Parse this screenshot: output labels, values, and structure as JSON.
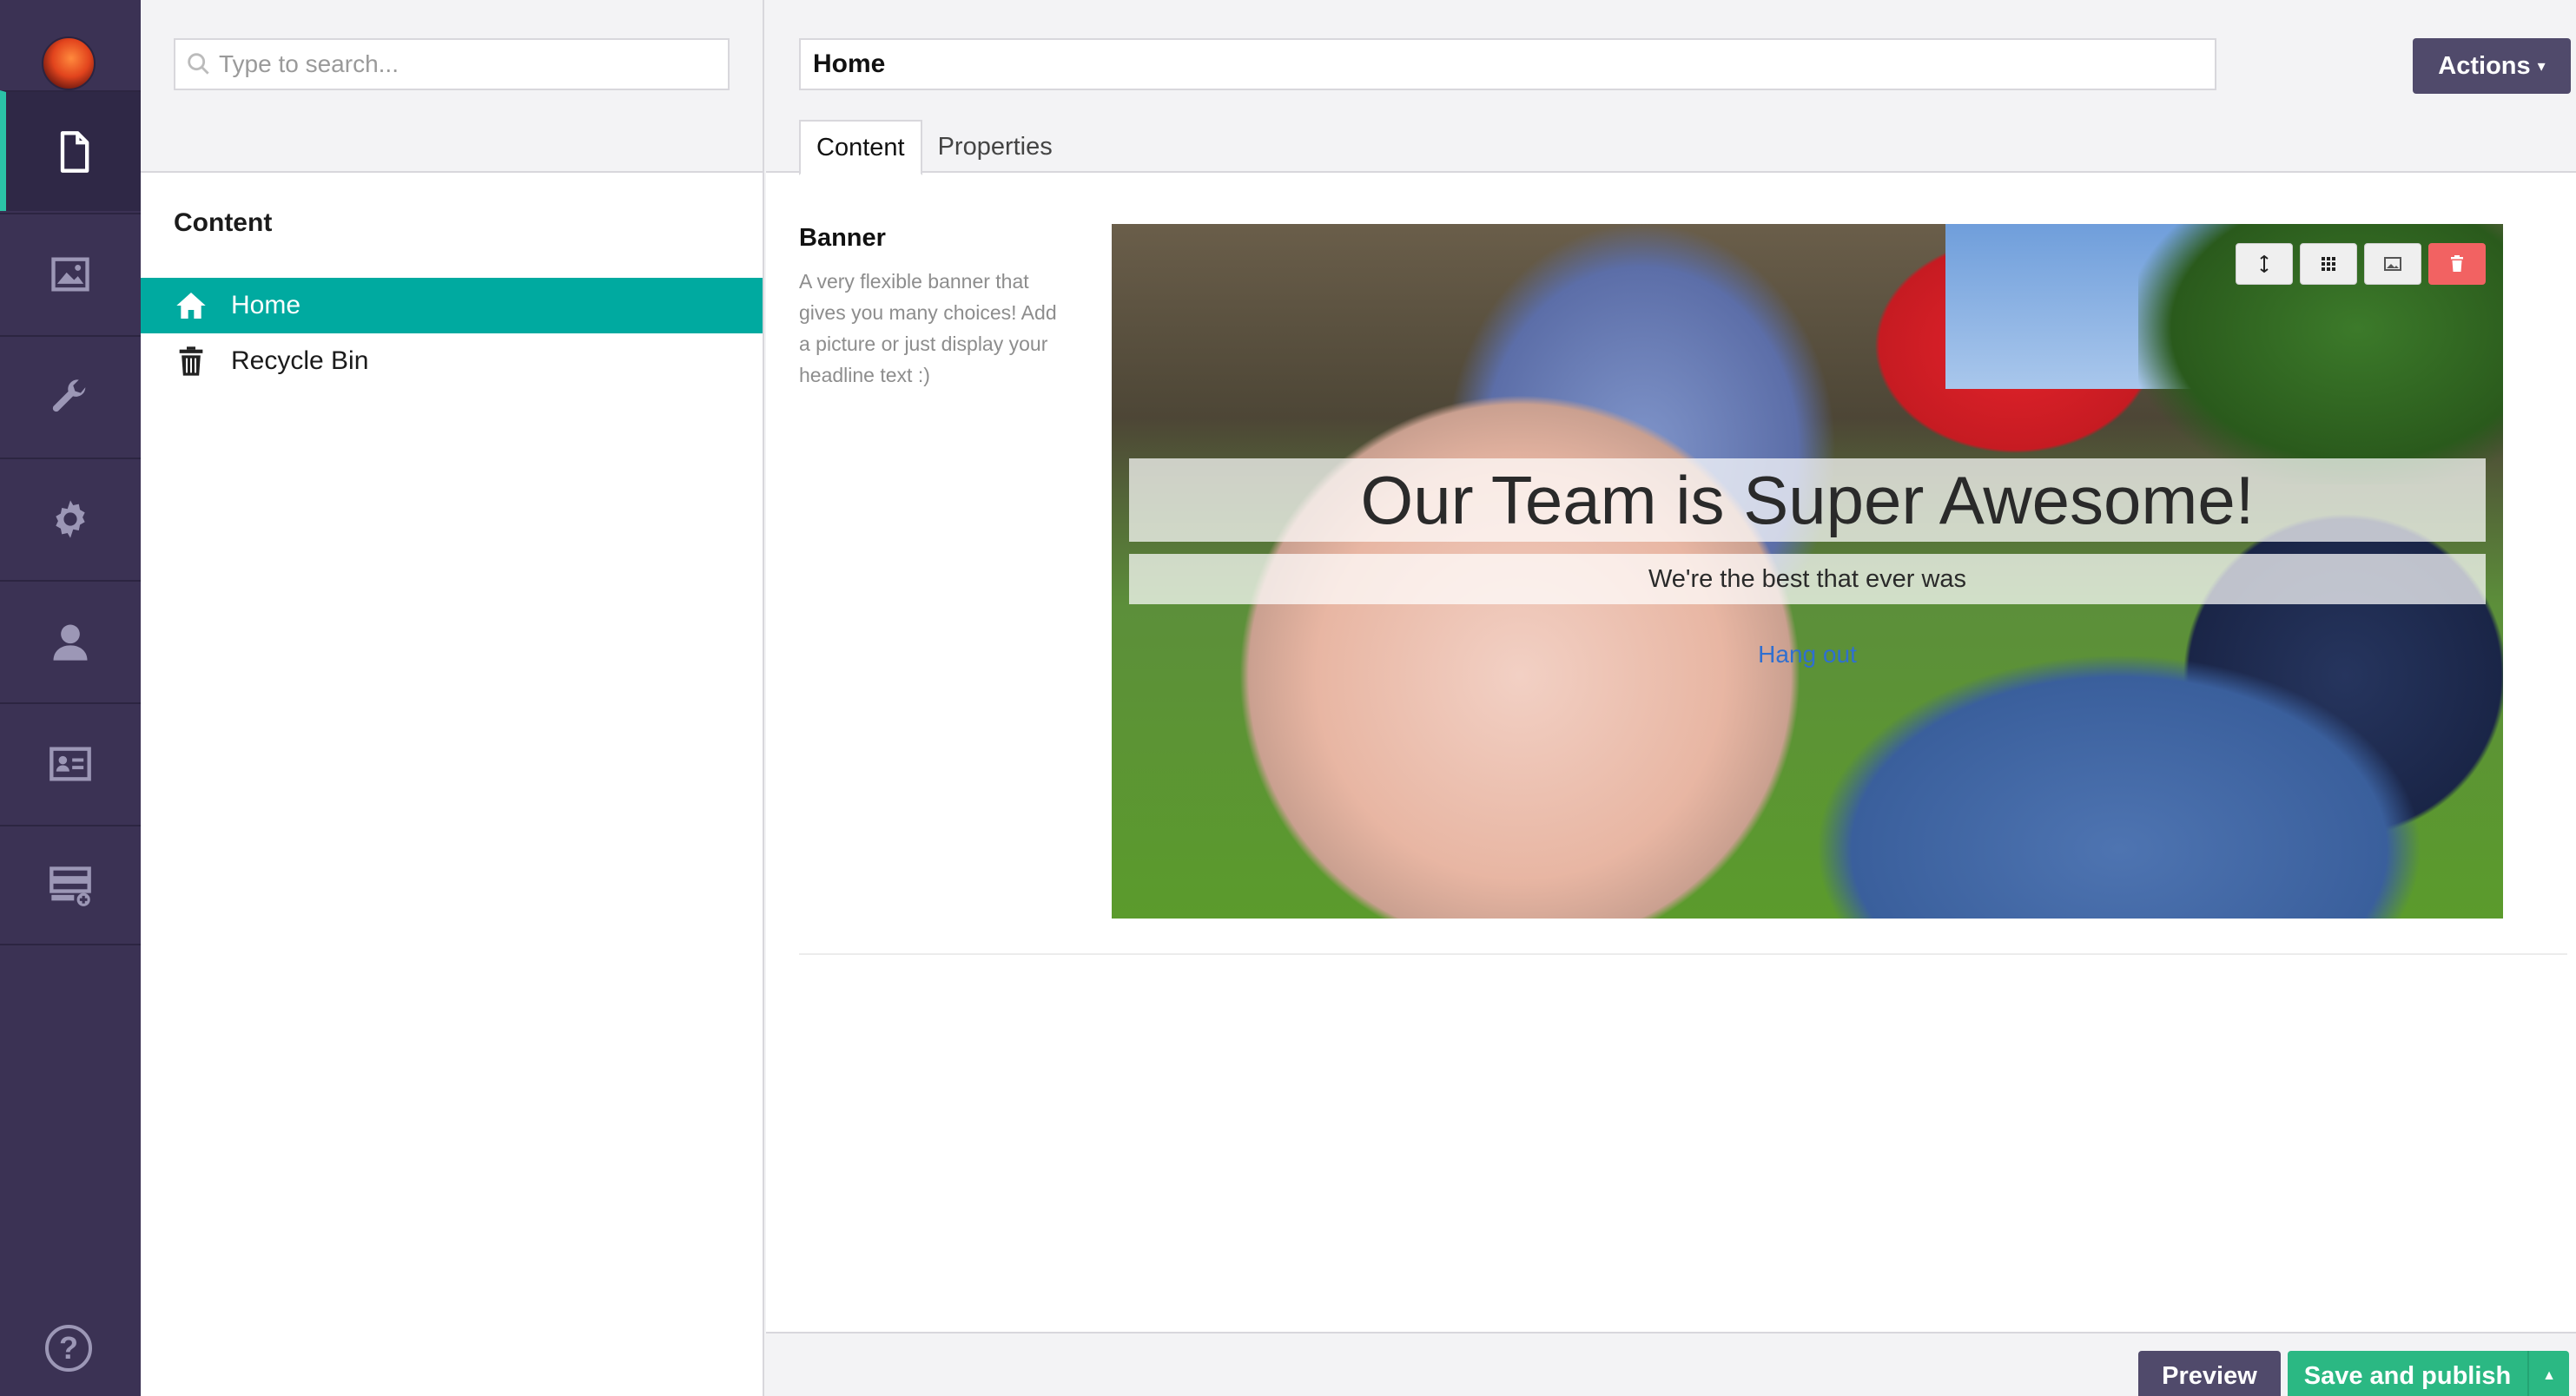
{
  "sidebar": {
    "sections": [
      {
        "name": "content",
        "icon": "document-icon",
        "active": true
      },
      {
        "name": "media",
        "icon": "image-icon",
        "active": false
      },
      {
        "name": "developer",
        "icon": "wrench-icon",
        "active": false
      },
      {
        "name": "settings",
        "icon": "gear-icon",
        "active": false
      },
      {
        "name": "users",
        "icon": "user-icon",
        "active": false
      },
      {
        "name": "members",
        "icon": "id-card-icon",
        "active": false
      },
      {
        "name": "forms",
        "icon": "form-icon",
        "active": false
      }
    ],
    "help_label": "?"
  },
  "tree": {
    "search_placeholder": "Type to search...",
    "title": "Content",
    "items": [
      {
        "label": "Home",
        "icon": "home-icon",
        "selected": true
      },
      {
        "label": "Recycle Bin",
        "icon": "trash-icon",
        "selected": false
      }
    ]
  },
  "editor": {
    "node_name": "Home",
    "actions_label": "Actions",
    "tabs": [
      {
        "label": "Content",
        "active": true
      },
      {
        "label": "Properties",
        "active": false
      }
    ],
    "property": {
      "label": "Banner",
      "description": "A very flexible banner that gives you many choices! Add a picture or just display your headline text :)"
    },
    "banner": {
      "headline": "Our Team is Super Awesome!",
      "subheadline": "We're the best that ever was",
      "link_text": "Hang out"
    },
    "footer": {
      "preview_label": "Preview",
      "publish_label": "Save and publish"
    }
  },
  "colors": {
    "sidebar_bg": "#3b3254",
    "accent_teal": "#00aaa0",
    "publish_green": "#2bb883",
    "button_purple": "#504a6b",
    "danger_red": "#f26262"
  }
}
